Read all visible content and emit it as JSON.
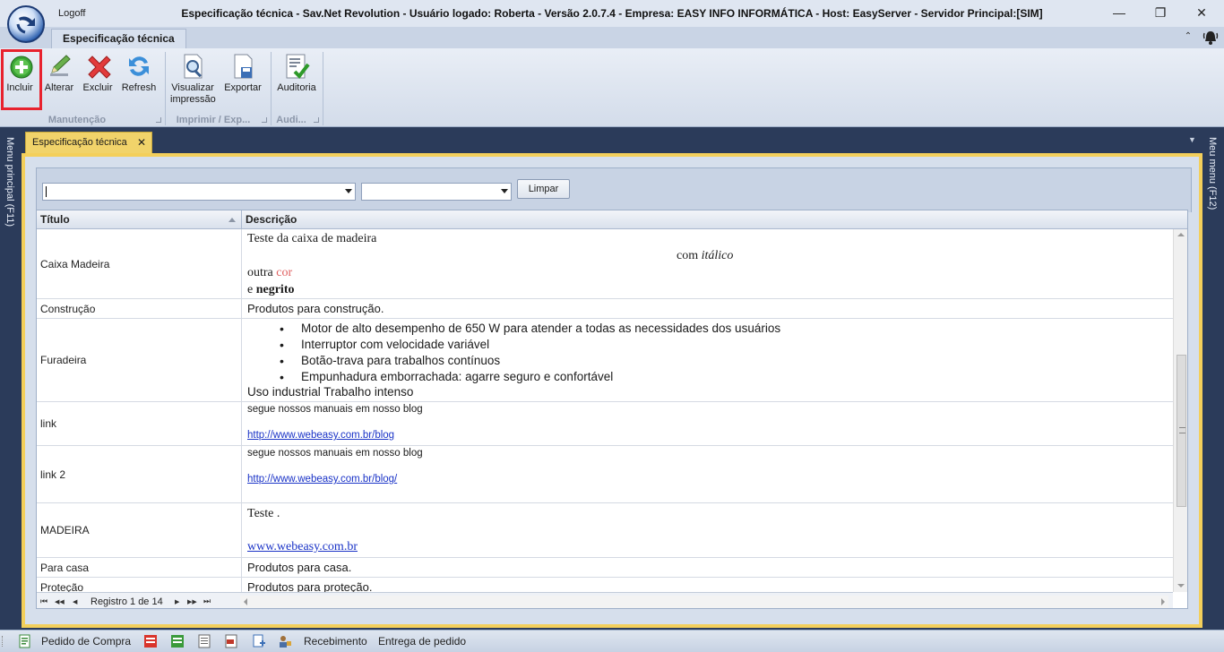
{
  "window": {
    "logoff": "Logoff",
    "title": "Especificação técnica - Sav.Net Revolution - Usuário logado: Roberta - Versão 2.0.7.4 - Empresa: EASY INFO INFORMÁTICA - Host: EasyServer - Servidor Principal:[SIM]",
    "minimize": "—",
    "restore": "❐",
    "close": "✕"
  },
  "ribbon": {
    "tab": "Especificação técnica",
    "collapse": "⌃",
    "buttons": {
      "incluir": "Incluir",
      "alterar": "Alterar",
      "excluir": "Excluir",
      "refresh": "Refresh",
      "visualizar": "Visualizar",
      "visualizar2": "impressão",
      "exportar": "Exportar",
      "auditoria": "Auditoria"
    },
    "groups": {
      "manutencao": "Manutenção",
      "imprimir": "Imprimir / Exp...",
      "audi": "Audi..."
    }
  },
  "side": {
    "left": "Menu principal (F11)",
    "right": "Meu menu (F12)"
  },
  "document": {
    "tab": "Especificação técnica",
    "tab_close": "✕",
    "menu_arrow": "▼"
  },
  "filter": {
    "combo1_value": "",
    "combo2_value": "",
    "limpar": "Limpar"
  },
  "grid": {
    "columns": {
      "titulo": "Título",
      "descricao": "Descrição"
    },
    "rows": {
      "caixa": {
        "titulo": "Caixa Madeira",
        "l1": "Teste da caixa de madeira",
        "l2a": "com ",
        "l2b": "itálico",
        "l3a": "outra ",
        "l3b": "cor",
        "l4a": "e ",
        "l4b": "negrito"
      },
      "construcao": {
        "titulo": "Construção",
        "desc": "Produtos para construção."
      },
      "furadeira": {
        "titulo": "Furadeira",
        "b1": "Motor de alto desempenho de 650 W para atender a todas as necessidades dos usuários",
        "b2": "Interruptor com velocidade variável",
        "b3": "Botão-trava para trabalhos contínuos",
        "b4": "Empunhadura emborrachada: agarre seguro e confortável",
        "tail": "Uso industrial Trabalho intenso"
      },
      "link": {
        "titulo": "link",
        "text": "segue nossos manuais em nosso blog",
        "url": "http://www.webeasy.com.br/blog"
      },
      "link2": {
        "titulo": "link 2",
        "text": "segue nossos manuais em nosso blog",
        "url": "http://www.webeasy.com.br/blog/"
      },
      "madeira": {
        "titulo": "MADEIRA",
        "text": "Teste .",
        "url": "www.webeasy.com.br"
      },
      "paracasa": {
        "titulo": "Para casa",
        "desc": "Produtos para casa."
      },
      "protecao": {
        "titulo": "Proteção",
        "desc": "Produtos para proteção."
      }
    },
    "navigator": {
      "first": "⏮",
      "prev_page": "◀◀",
      "prev": "◀",
      "record": "Registro 1 de 14",
      "next": "▶",
      "next_page": "▶▶",
      "last": "⏭"
    },
    "selected_record": 1,
    "total_records": 14
  },
  "statusbar": {
    "pedido": "Pedido de Compra",
    "recebimento": "Recebimento",
    "entrega": "Entrega de pedido"
  },
  "colors": {
    "accent_highlight": "#e8222e",
    "doc_tab": "#f1d36a",
    "link": "#1a33c7",
    "cor_text": "#e06060"
  }
}
